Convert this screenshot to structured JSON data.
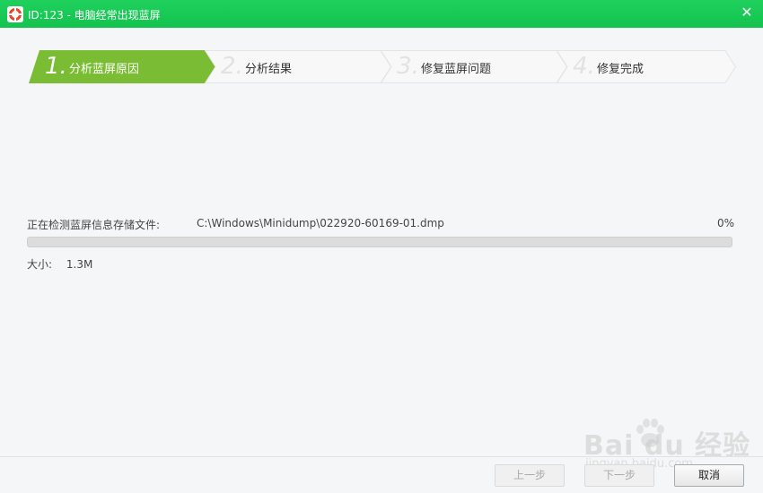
{
  "window": {
    "title": "ID:123 - 电脑经常出现蓝屏",
    "close_icon": "close-icon"
  },
  "steps": [
    {
      "number": "1.",
      "label": "分析蓝屏原因",
      "active": true
    },
    {
      "number": "2.",
      "label": "分析结果",
      "active": false
    },
    {
      "number": "3.",
      "label": "修复蓝屏问题",
      "active": false
    },
    {
      "number": "4.",
      "label": "修复完成",
      "active": false
    }
  ],
  "scan": {
    "label": "正在检测蓝屏信息存储文件:",
    "file": "C:\\Windows\\Minidump\\022920-60169-01.dmp",
    "percent_text": "0%",
    "progress": 0
  },
  "size": {
    "label": "大小:",
    "value": "1.3M"
  },
  "buttons": {
    "prev": "上一步",
    "next": "下一步",
    "cancel": "取消"
  },
  "watermark": {
    "main": "Bai du 经验",
    "sub": "jingyan.baidu.com"
  },
  "colors": {
    "titlebar": "#1ad056",
    "active_step": "#7abc33",
    "inactive_step": "#f8f8f8"
  }
}
